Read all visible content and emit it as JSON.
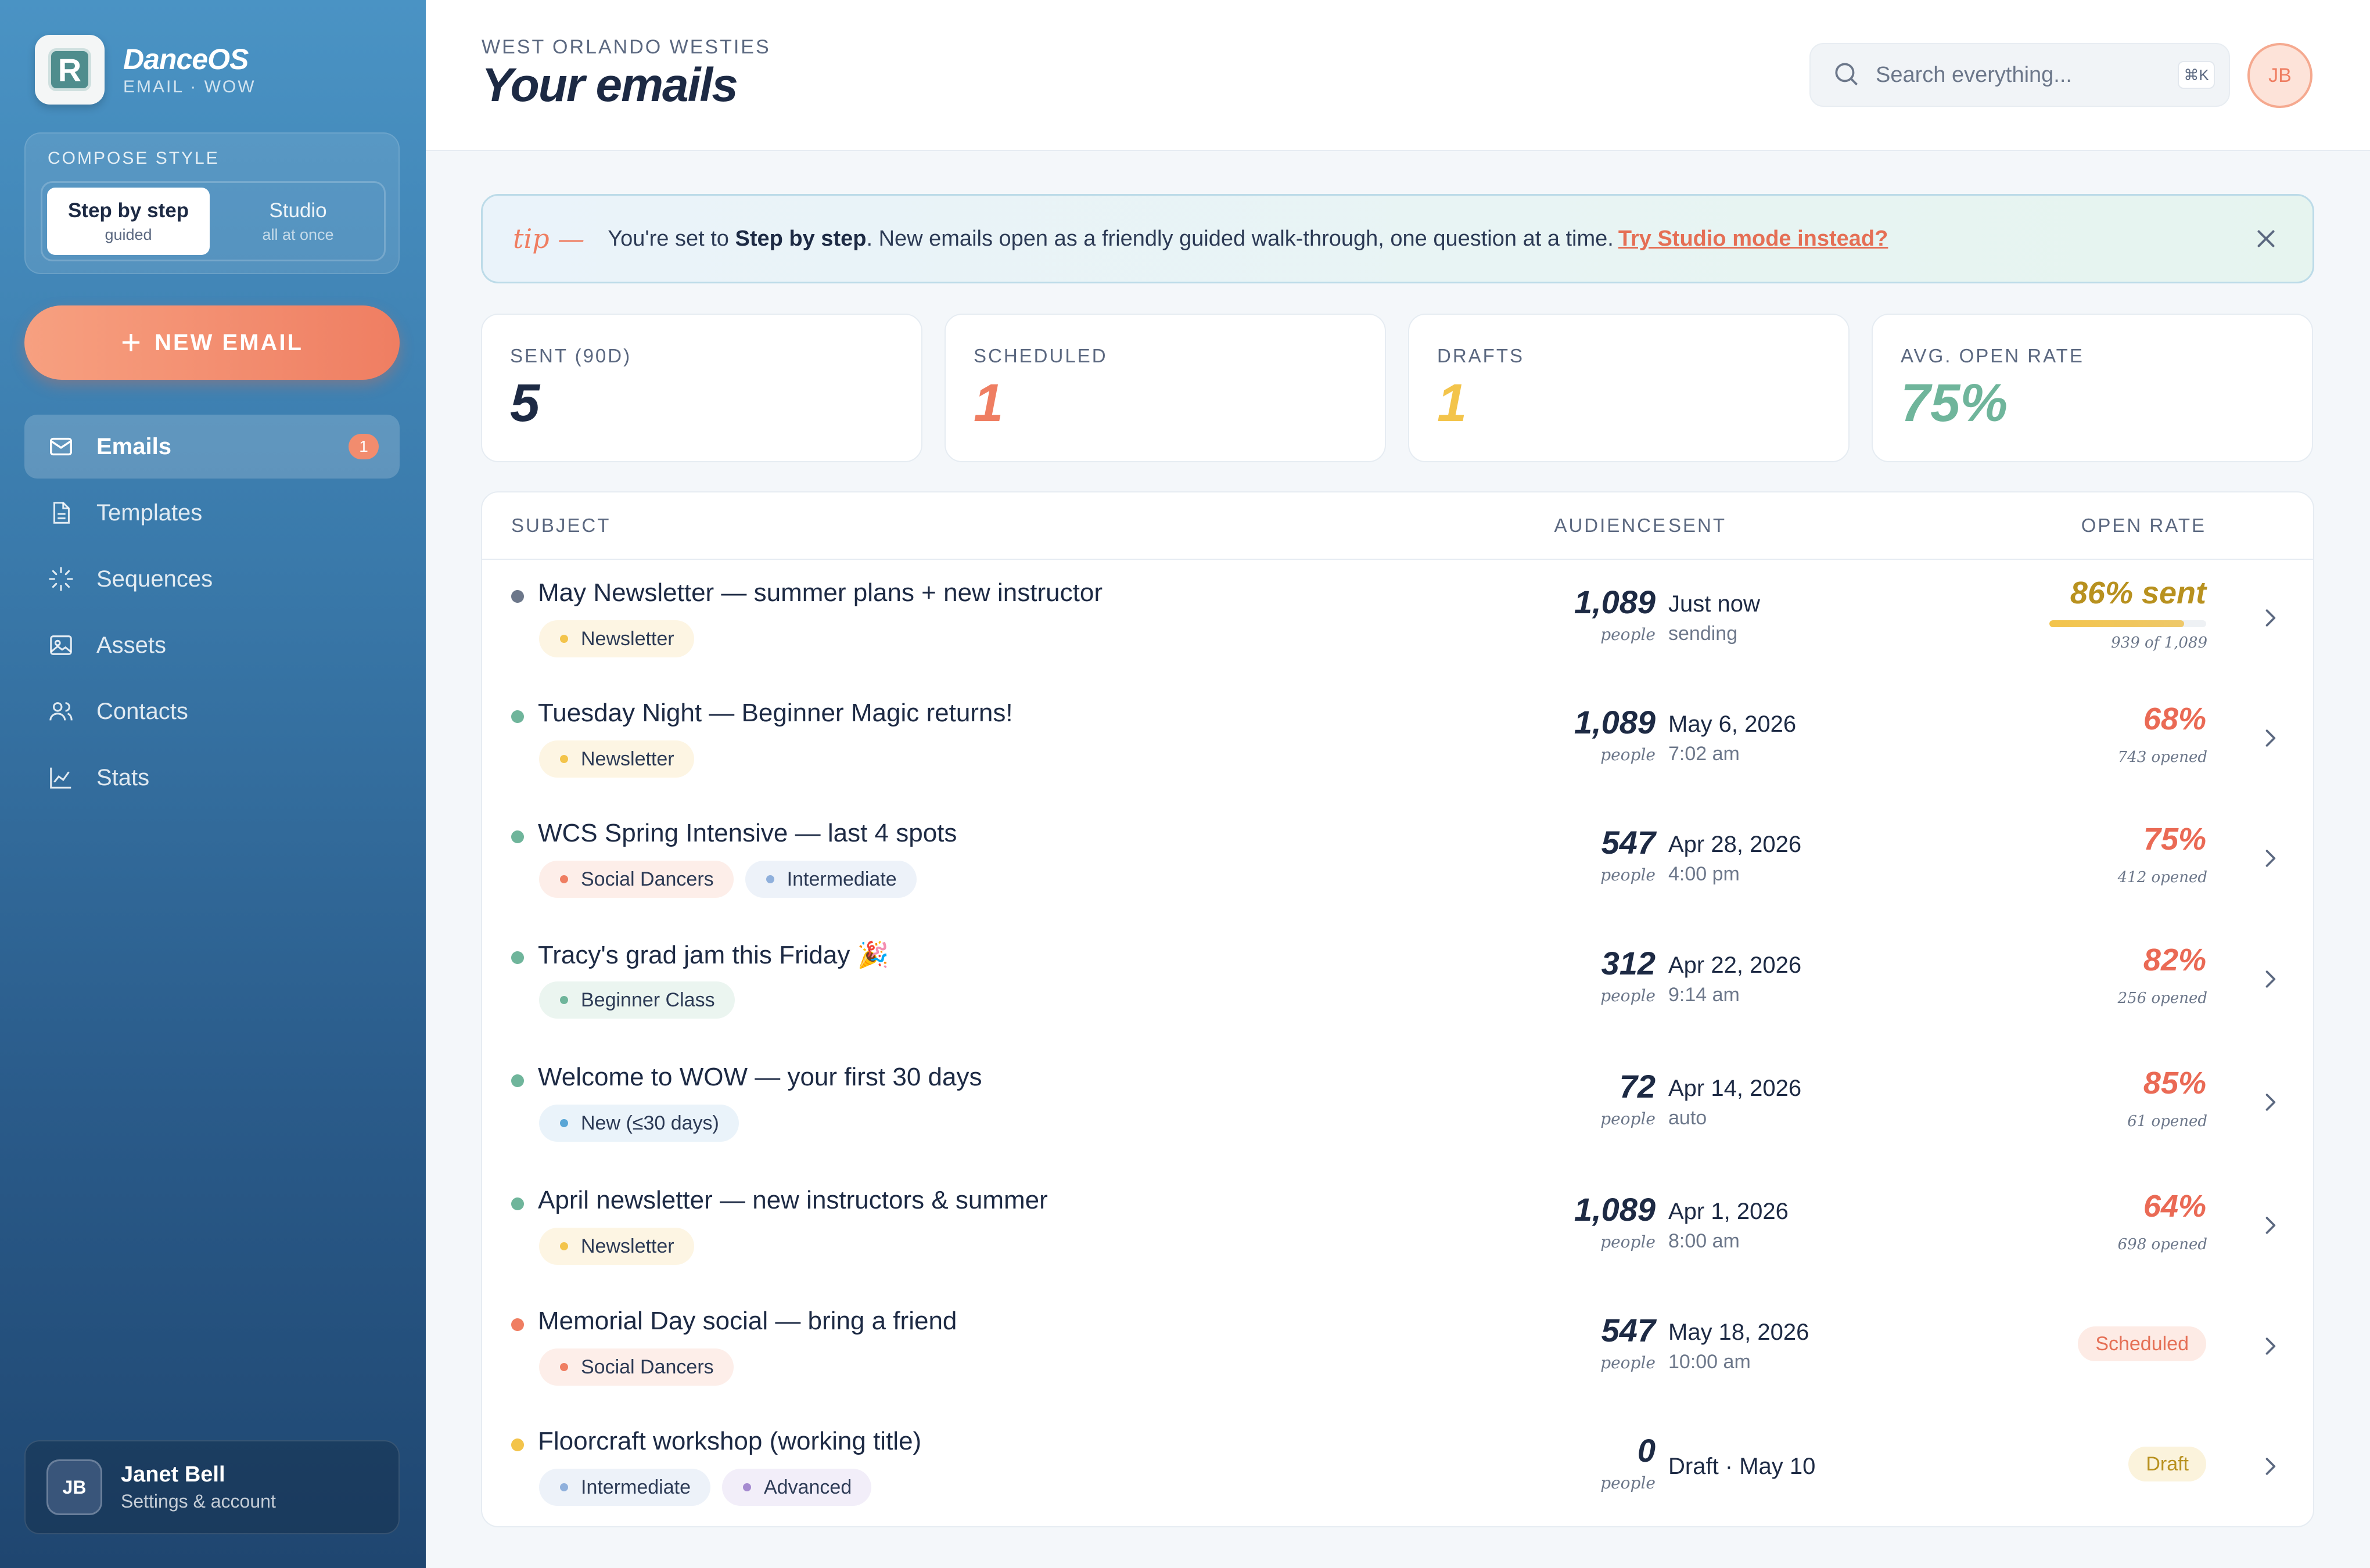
{
  "brand": {
    "name": "DanceOS",
    "sub": "EMAIL · WOW",
    "logo_letter": "R"
  },
  "compose": {
    "title": "COMPOSE STYLE",
    "options": [
      {
        "label": "Step by step",
        "sub": "guided"
      },
      {
        "label": "Studio",
        "sub": "all at once"
      }
    ]
  },
  "new_email": {
    "label": "NEW EMAIL",
    "icon": "plus-icon"
  },
  "nav": [
    {
      "label": "Emails",
      "icon": "mail-icon",
      "badge": "1",
      "active": true
    },
    {
      "label": "Templates",
      "icon": "document-icon"
    },
    {
      "label": "Sequences",
      "icon": "loader-icon"
    },
    {
      "label": "Assets",
      "icon": "image-icon"
    },
    {
      "label": "Contacts",
      "icon": "users-icon"
    },
    {
      "label": "Stats",
      "icon": "chart-line-icon"
    }
  ],
  "account": {
    "initials": "JB",
    "name": "Janet Bell",
    "sub": "Settings & account"
  },
  "header": {
    "org": "WEST ORLANDO WESTIES",
    "title": "Your emails",
    "search_placeholder": "Search everything...",
    "shortcut": "⌘K",
    "avatar": "JB"
  },
  "tip": {
    "label": "tip —",
    "text_before": "You're set to ",
    "text_bold": "Step by step",
    "text_after": ". New emails open as a friendly guided walk-through, one question at a time.",
    "link": "Try Studio mode instead?"
  },
  "stats": [
    {
      "label": "SENT (90D)",
      "value": "5",
      "color": "#1d2a44"
    },
    {
      "label": "SCHEDULED",
      "value": "1",
      "color": "#ef7e62"
    },
    {
      "label": "DRAFTS",
      "value": "1",
      "color": "#f3c44b"
    },
    {
      "label": "AVG. OPEN RATE",
      "value": "75%",
      "color": "#6fb59b"
    }
  ],
  "table": {
    "headers": {
      "subject": "SUBJECT",
      "audience": "AUDIENCE",
      "sent": "SENT",
      "open_rate": "OPEN RATE"
    },
    "rows": [
      {
        "subject": "May Newsletter — summer plans + new instructor",
        "dot": "#6c778a",
        "tags": [
          {
            "label": "Newsletter",
            "color": "#f3c44b",
            "bg": "#fdf5e3"
          }
        ],
        "audience": "1,089",
        "audience_unit": "people",
        "sent": "Just now",
        "sent_sub": "sending",
        "rate": "86% sent",
        "rate_color": "#b8911f",
        "rate_sub": "939 of 1,089",
        "progress": 0.86,
        "kind": "progress"
      },
      {
        "subject": "Tuesday Night — Beginner Magic returns!",
        "dot": "#6fb59b",
        "tags": [
          {
            "label": "Newsletter",
            "color": "#f3c44b",
            "bg": "#fdf5e3"
          }
        ],
        "audience": "1,089",
        "audience_unit": "people",
        "sent": "May 6, 2026",
        "sent_sub": "7:02 am",
        "rate": "68%",
        "rate_color": "#ea6a55",
        "rate_sub": "743 opened",
        "kind": "rate"
      },
      {
        "subject": "WCS Spring Intensive — last 4 spots",
        "dot": "#6fb59b",
        "tags": [
          {
            "label": "Social Dancers",
            "color": "#ef7e62",
            "bg": "#fdeee9"
          },
          {
            "label": "Intermediate",
            "color": "#8fb0dc",
            "bg": "#edf2f9"
          }
        ],
        "audience": "547",
        "audience_unit": "people",
        "sent": "Apr 28, 2026",
        "sent_sub": "4:00 pm",
        "rate": "75%",
        "rate_color": "#ea6a55",
        "rate_sub": "412 opened",
        "kind": "rate"
      },
      {
        "subject": "Tracy's grad jam this Friday 🎉",
        "dot": "#6fb59b",
        "tags": [
          {
            "label": "Beginner Class",
            "color": "#6fb59b",
            "bg": "#ebf5f0"
          }
        ],
        "audience": "312",
        "audience_unit": "people",
        "sent": "Apr 22, 2026",
        "sent_sub": "9:14 am",
        "rate": "82%",
        "rate_color": "#ea6a55",
        "rate_sub": "256 opened",
        "kind": "rate"
      },
      {
        "subject": "Welcome to WOW — your first 30 days",
        "dot": "#6fb59b",
        "tags": [
          {
            "label": "New (≤30 days)",
            "color": "#5aa6d6",
            "bg": "#eaf3fa"
          }
        ],
        "audience": "72",
        "audience_unit": "people",
        "sent": "Apr 14, 2026",
        "sent_sub": "auto",
        "rate": "85%",
        "rate_color": "#ea6a55",
        "rate_sub": "61 opened",
        "kind": "rate"
      },
      {
        "subject": "April newsletter — new instructors & summer",
        "dot": "#6fb59b",
        "tags": [
          {
            "label": "Newsletter",
            "color": "#f3c44b",
            "bg": "#fdf5e3"
          }
        ],
        "audience": "1,089",
        "audience_unit": "people",
        "sent": "Apr 1, 2026",
        "sent_sub": "8:00 am",
        "rate": "64%",
        "rate_color": "#ea6a55",
        "rate_sub": "698 opened",
        "kind": "rate"
      },
      {
        "subject": "Memorial Day social — bring a friend",
        "dot": "#ef7e62",
        "tags": [
          {
            "label": "Social Dancers",
            "color": "#ef7e62",
            "bg": "#fdeee9"
          }
        ],
        "audience": "547",
        "audience_unit": "people",
        "sent": "May 18, 2026",
        "sent_sub": "10:00 am",
        "status": "Scheduled",
        "status_color": "#e56f55",
        "status_bg": "#fdebe5",
        "kind": "status"
      },
      {
        "subject": "Floorcraft workshop (working title)",
        "dot": "#f3c44b",
        "tags": [
          {
            "label": "Intermediate",
            "color": "#8fb0dc",
            "bg": "#edf2f9"
          },
          {
            "label": "Advanced",
            "color": "#a58ad0",
            "bg": "#f2eef9"
          }
        ],
        "audience": "0",
        "audience_unit": "people",
        "sent": "Draft · May 10",
        "sent_sub": "",
        "status": "Draft",
        "status_color": "#b8911f",
        "status_bg": "#fbf3dc",
        "kind": "status"
      }
    ]
  }
}
